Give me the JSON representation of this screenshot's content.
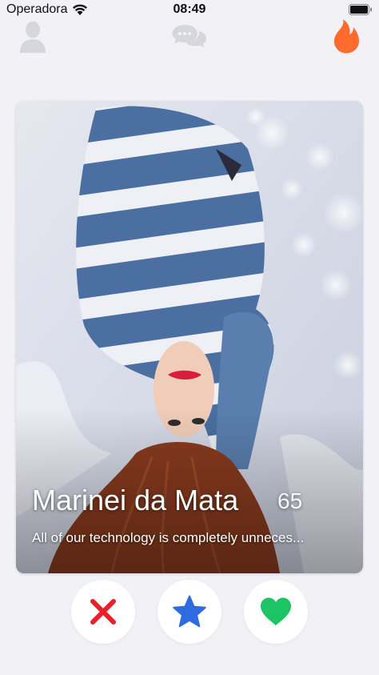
{
  "status_bar": {
    "carrier": "Operadora",
    "time": "08:49"
  },
  "nav": {
    "icons": [
      "profile-icon",
      "chat-bubbles-icon",
      "flame-icon"
    ],
    "active_color": "#FF6B2C",
    "inactive_color": "#D5D7DD"
  },
  "card": {
    "name": "Marinei da Mata",
    "age": "65",
    "bio": "All of our technology is completely unneces..."
  },
  "actions": {
    "nope_color": "#E8202A",
    "super_like_color": "#2F6BE0",
    "like_color": "#1CC464"
  }
}
